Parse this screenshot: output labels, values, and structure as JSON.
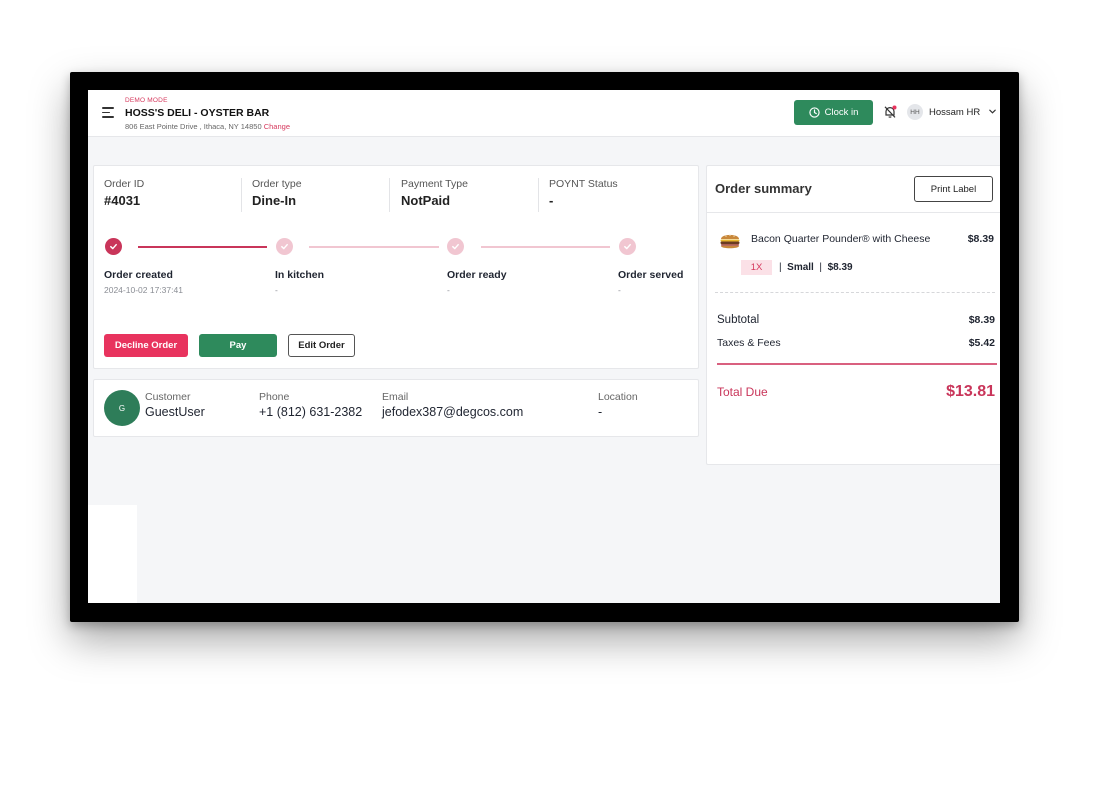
{
  "header": {
    "demo_mode": "DEMO MODE",
    "store_name": "HOSS'S DELI - OYSTER BAR",
    "address": "806 East Pointe Drive , Ithaca, NY 14850",
    "change_link": "Change",
    "clock_in_label": "Clock in",
    "user_initials": "HH",
    "user_name": "Hossam HR"
  },
  "order": {
    "meta": [
      {
        "label": "Order ID",
        "value": "#4031"
      },
      {
        "label": "Order type",
        "value": "Dine-In"
      },
      {
        "label": "Payment Type",
        "value": "NotPaid"
      },
      {
        "label": "POYNT Status",
        "value": "-"
      }
    ],
    "steps": [
      {
        "label": "Order created",
        "sub": "2024-10-02 17:37:41",
        "done": true
      },
      {
        "label": "In kitchen",
        "sub": "-",
        "done": false
      },
      {
        "label": "Order ready",
        "sub": "-",
        "done": false
      },
      {
        "label": "Order served",
        "sub": "-",
        "done": false
      }
    ],
    "buttons": {
      "decline": "Decline Order",
      "pay": "Pay",
      "edit": "Edit Order"
    }
  },
  "customer": {
    "avatar_initial": "G",
    "fields": [
      {
        "label": "Customer",
        "value": "GuestUser"
      },
      {
        "label": "Phone",
        "value": "+1 (812) 631-2382"
      },
      {
        "label": "Email",
        "value": "jefodex387@degcos.com"
      },
      {
        "label": "Location",
        "value": "-"
      }
    ]
  },
  "summary": {
    "title": "Order summary",
    "print_label": "Print Label",
    "item": {
      "name": "Bacon Quarter Pounder® with Cheese",
      "price": "$8.39",
      "qty": "1X",
      "size": "Small",
      "unit_price": "$8.39"
    },
    "subtotal_label": "Subtotal",
    "subtotal": "$8.39",
    "taxes_label": "Taxes & Fees",
    "taxes": "$5.42",
    "total_label": "Total Due",
    "total": "$13.81"
  },
  "colors": {
    "primary_green": "#2e8a5c",
    "accent_red": "#c9355a",
    "decline_red": "#e8335e"
  }
}
